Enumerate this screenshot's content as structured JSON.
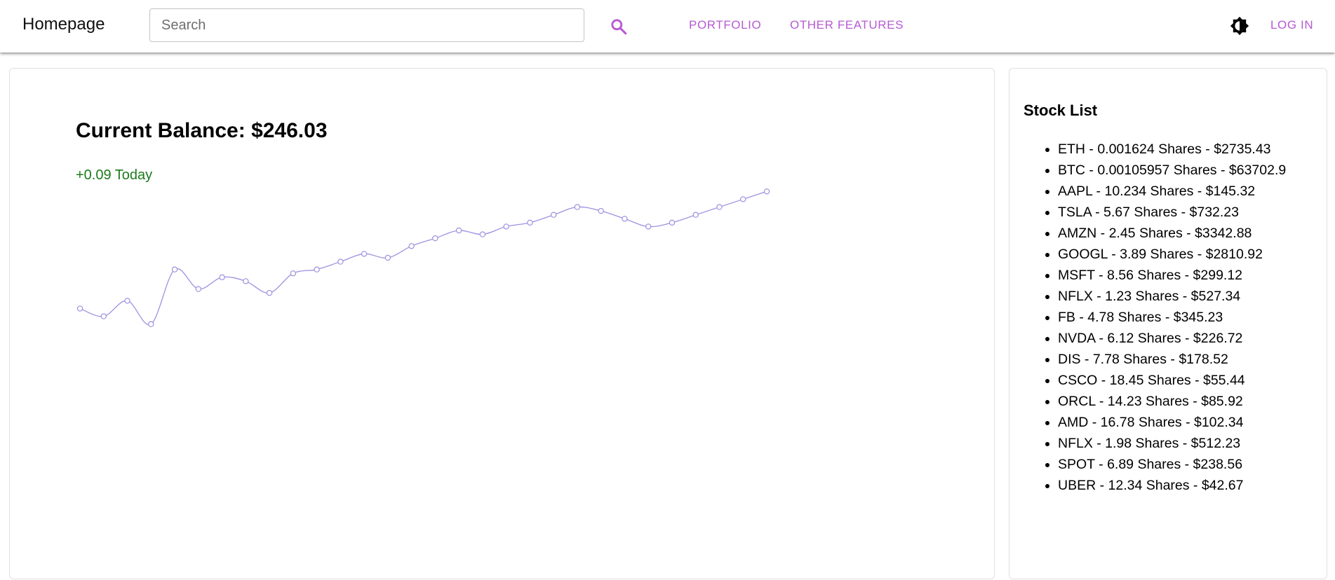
{
  "header": {
    "brand": "Homepage",
    "search_placeholder": "Search",
    "search_value": "",
    "nav": [
      "PORTFOLIO",
      "OTHER FEATURES"
    ],
    "login_label": "LOG IN",
    "icons": {
      "search": "search-icon",
      "theme": "brightness-icon"
    },
    "accent_color": "#b65ad1"
  },
  "balance": {
    "title": "Current Balance: $246.03",
    "change": "+0.09 Today",
    "change_color": "#1b7a1b"
  },
  "chart_data": {
    "type": "line",
    "title": "",
    "xlabel": "",
    "ylabel": "",
    "grid": false,
    "legend": "none",
    "line_color": "#9d91e0",
    "series": [
      {
        "values": [
          240.6,
          240.0,
          241.2,
          239.4,
          243.6,
          242.1,
          243.0,
          242.7,
          241.8,
          243.3,
          243.6,
          244.2,
          244.8,
          244.5,
          245.4,
          246.0,
          246.6,
          246.3,
          246.9,
          247.2,
          247.8,
          248.4,
          248.1,
          247.5,
          246.9,
          247.2,
          247.8,
          248.4,
          249.0,
          249.6
        ]
      }
    ],
    "ylim": [
      220,
      255
    ]
  },
  "stocks": {
    "title": "Stock List",
    "items": [
      "ETH - 0.001624 Shares - $2735.43",
      "BTC - 0.00105957 Shares - $63702.9",
      "AAPL - 10.234 Shares - $145.32",
      "TSLA - 5.67 Shares - $732.23",
      "AMZN - 2.45 Shares - $3342.88",
      "GOOGL - 3.89 Shares - $2810.92",
      "MSFT - 8.56 Shares - $299.12",
      "NFLX - 1.23 Shares - $527.34",
      "FB - 4.78 Shares - $345.23",
      "NVDA - 6.12 Shares - $226.72",
      "DIS - 7.78 Shares - $178.52",
      "CSCO - 18.45 Shares - $55.44",
      "ORCL - 14.23 Shares - $85.92",
      "AMD - 16.78 Shares - $102.34",
      "NFLX - 1.98 Shares - $512.23",
      "SPOT - 6.89 Shares - $238.56",
      "UBER - 12.34 Shares - $42.67"
    ]
  }
}
